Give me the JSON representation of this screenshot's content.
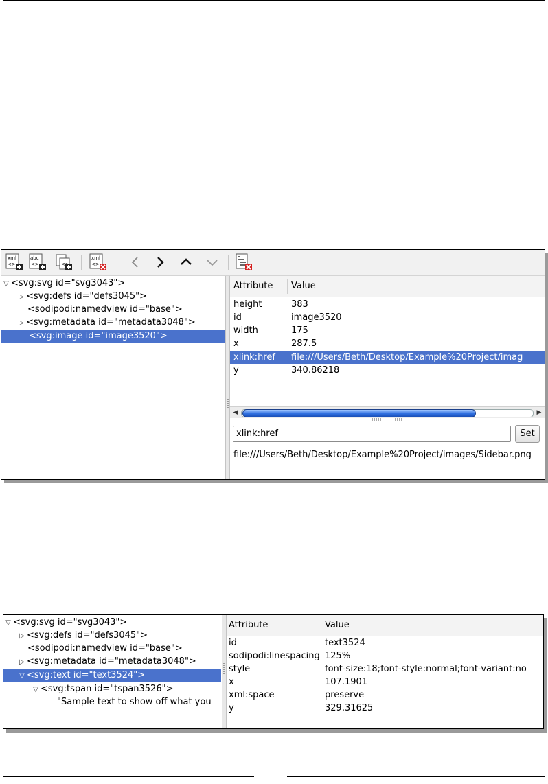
{
  "panel1": {
    "tree": [
      {
        "label": "<svg:svg id=\"svg3043\">",
        "toggle": "▽",
        "selected": false
      },
      {
        "label": "<svg:defs id=\"defs3045\">",
        "toggle": "▷",
        "selected": false
      },
      {
        "label": "<sodipodi:namedview id=\"base\">",
        "toggle": "",
        "selected": false
      },
      {
        "label": "<svg:metadata id=\"metadata3048\">",
        "toggle": "▷",
        "selected": false
      },
      {
        "label": "<svg:image id=\"image3520\">",
        "toggle": "",
        "selected": true
      }
    ],
    "columns": {
      "attribute": "Attribute",
      "value": "Value"
    },
    "attributes": [
      {
        "name": "height",
        "value": "383"
      },
      {
        "name": "id",
        "value": "image3520"
      },
      {
        "name": "width",
        "value": "175"
      },
      {
        "name": "x",
        "value": "287.5"
      },
      {
        "name": "xlink:href",
        "value": "file:///Users/Beth/Desktop/Example%20Project/imag"
      },
      {
        "name": "y",
        "value": "340.86218"
      }
    ],
    "attr_name_input": "xlink:href",
    "set_label": "Set",
    "value_editor_text": "file:///Users/Beth/Desktop/Example%20Project/images/Sidebar.png",
    "toolbar_icons": [
      "new-element-node-icon",
      "new-text-node-icon",
      "duplicate-node-icon",
      "delete-node-icon",
      "unindent-node-icon",
      "indent-node-icon",
      "raise-node-icon",
      "lower-node-icon",
      "delete-attribute-icon"
    ]
  },
  "panel2": {
    "tree": [
      {
        "label": "<svg:svg id=\"svg3043\">",
        "toggle": "▽",
        "selected": false
      },
      {
        "label": "<svg:defs id=\"defs3045\">",
        "toggle": "▷",
        "selected": false
      },
      {
        "label": "<sodipodi:namedview id=\"base\">",
        "toggle": "",
        "selected": false
      },
      {
        "label": "<svg:metadata id=\"metadata3048\">",
        "toggle": "▷",
        "selected": false
      },
      {
        "label": "<svg:text id=\"text3524\">",
        "toggle": "▽",
        "selected": true
      },
      {
        "label": "<svg:tspan id=\"tspan3526\">",
        "toggle": "▽",
        "selected": false
      },
      {
        "label": "\"Sample text to show off what you",
        "toggle": "",
        "selected": false
      }
    ],
    "columns": {
      "attribute": "Attribute",
      "value": "Value"
    },
    "attributes": [
      {
        "name": "id",
        "value": "text3524"
      },
      {
        "name": "sodipodi:linespacing",
        "value": "125%"
      },
      {
        "name": "style",
        "value": "font-size:18;font-style:normal;font-variant:no"
      },
      {
        "name": "x",
        "value": "107.1901"
      },
      {
        "name": "xml:space",
        "value": "preserve"
      },
      {
        "name": "y",
        "value": "329.31625"
      }
    ]
  },
  "colors": {
    "selection": "#4a72cc",
    "scroll_thumb": "#2f6fe0",
    "delete_badge": "#d42020"
  }
}
